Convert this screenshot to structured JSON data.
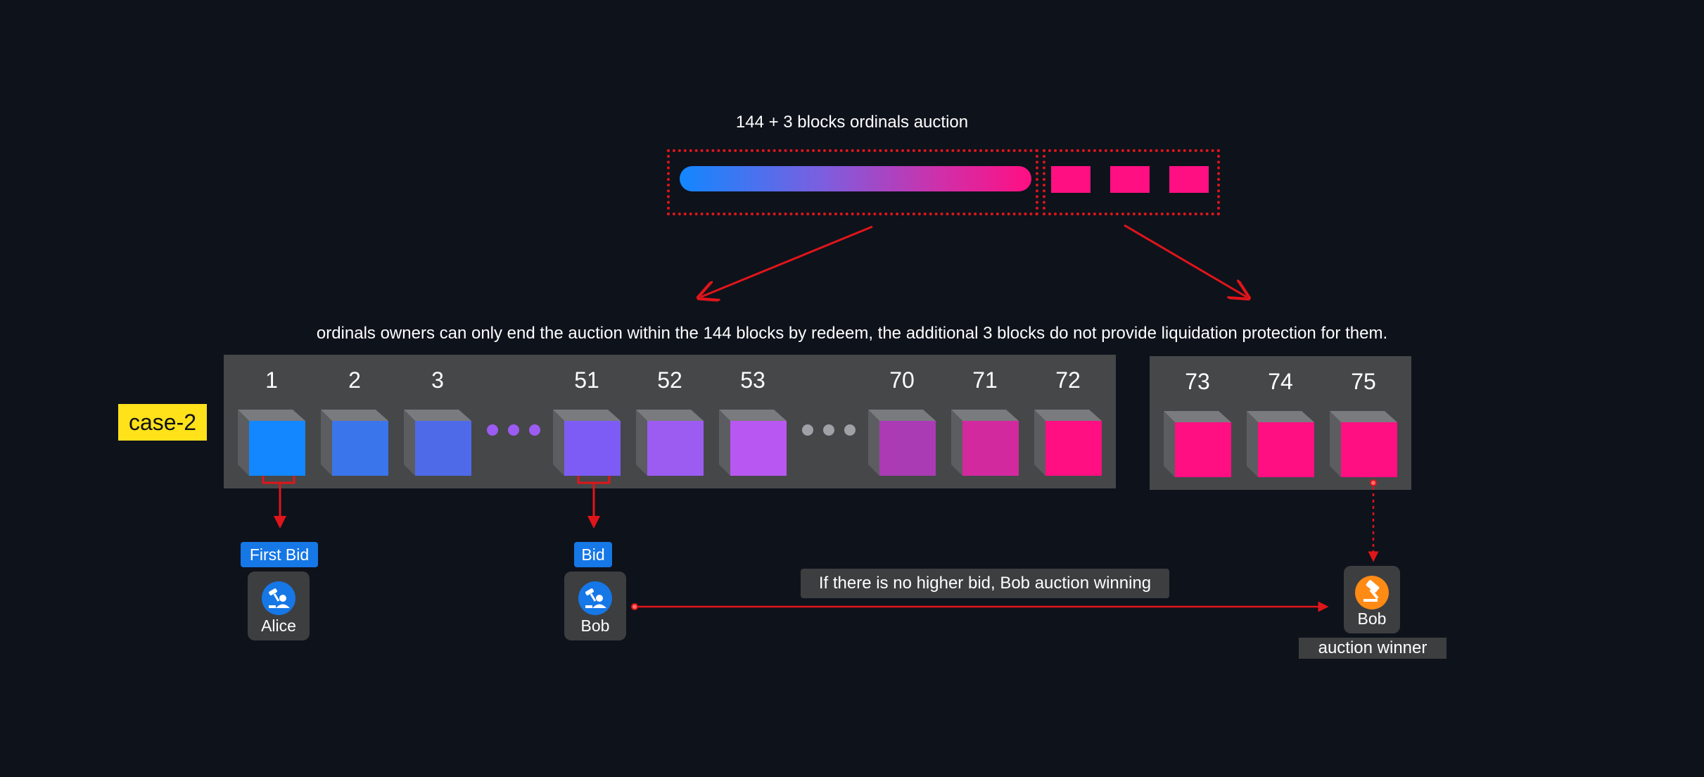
{
  "header": {
    "title": "144 + 3 blocks ordinals auction"
  },
  "description": "ordinals owners can only end the auction within the 144 blocks by redeem,  the additional 3 blocks do not provide liquidation protection for them.",
  "case_label": "case-2",
  "blocks_main": [
    {
      "label": "1",
      "color": "#1287ff"
    },
    {
      "label": "2",
      "color": "#3b75ec"
    },
    {
      "label": "3",
      "color": "#4e6ae8"
    },
    {
      "label": "51",
      "color": "#7d5cf5"
    },
    {
      "label": "52",
      "color": "#9c5cf2"
    },
    {
      "label": "53",
      "color": "#b957f2"
    },
    {
      "label": "70",
      "color": "#aa3bb5"
    },
    {
      "label": "71",
      "color": "#d2299f"
    },
    {
      "label": "72",
      "color": "#ff0f82"
    }
  ],
  "blocks_extra": [
    {
      "label": "73",
      "color": "#ff0f82"
    },
    {
      "label": "74",
      "color": "#ff0f82"
    },
    {
      "label": "75",
      "color": "#ff0f82"
    }
  ],
  "ellipsis_colors": {
    "first": "#9c5cf2",
    "second": "#a0a1a6"
  },
  "bids": {
    "first": {
      "label": "First Bid",
      "user": "Alice"
    },
    "second": {
      "label": "Bid",
      "user": "Bob"
    }
  },
  "message": "If there is no higher bid, Bob auction winning",
  "winner": {
    "user": "Bob",
    "label": "auction winner"
  },
  "colors": {
    "accent_red": "#e0151a",
    "bid_blue": "#1677e6",
    "winner_orange": "#ff8a14",
    "pink": "#ff0f82"
  },
  "icons": {
    "bidder": "person-auction-icon",
    "winner": "gavel-icon"
  }
}
